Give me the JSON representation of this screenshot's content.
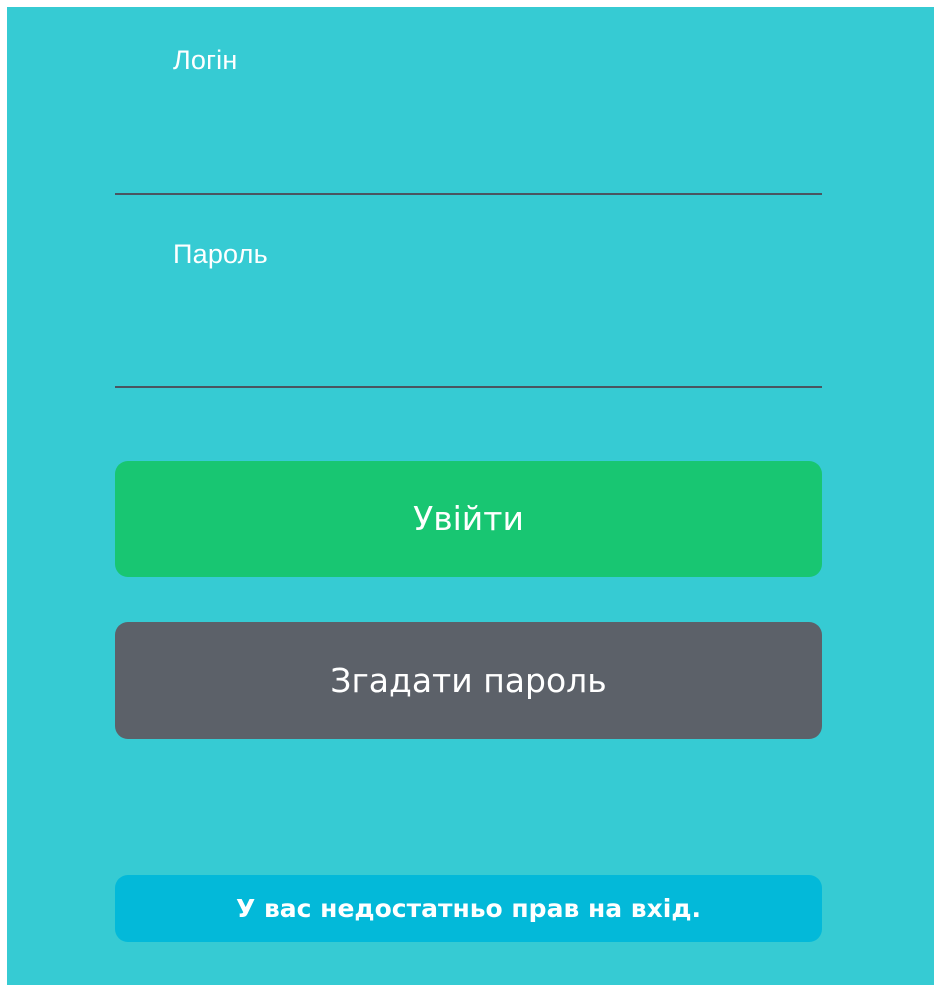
{
  "login": {
    "label": "Логін",
    "value": ""
  },
  "password": {
    "label": "Пароль",
    "value": ""
  },
  "buttons": {
    "login_label": "Увійти",
    "remind_label": "Згадати пароль"
  },
  "alert": {
    "message": "У вас недостатньо прав на вхід."
  },
  "colors": {
    "background": "#36cbd3",
    "login_button": "#18c672",
    "remind_button": "#5c6169",
    "alert": "#03b9d9",
    "underline": "#4a5560"
  }
}
